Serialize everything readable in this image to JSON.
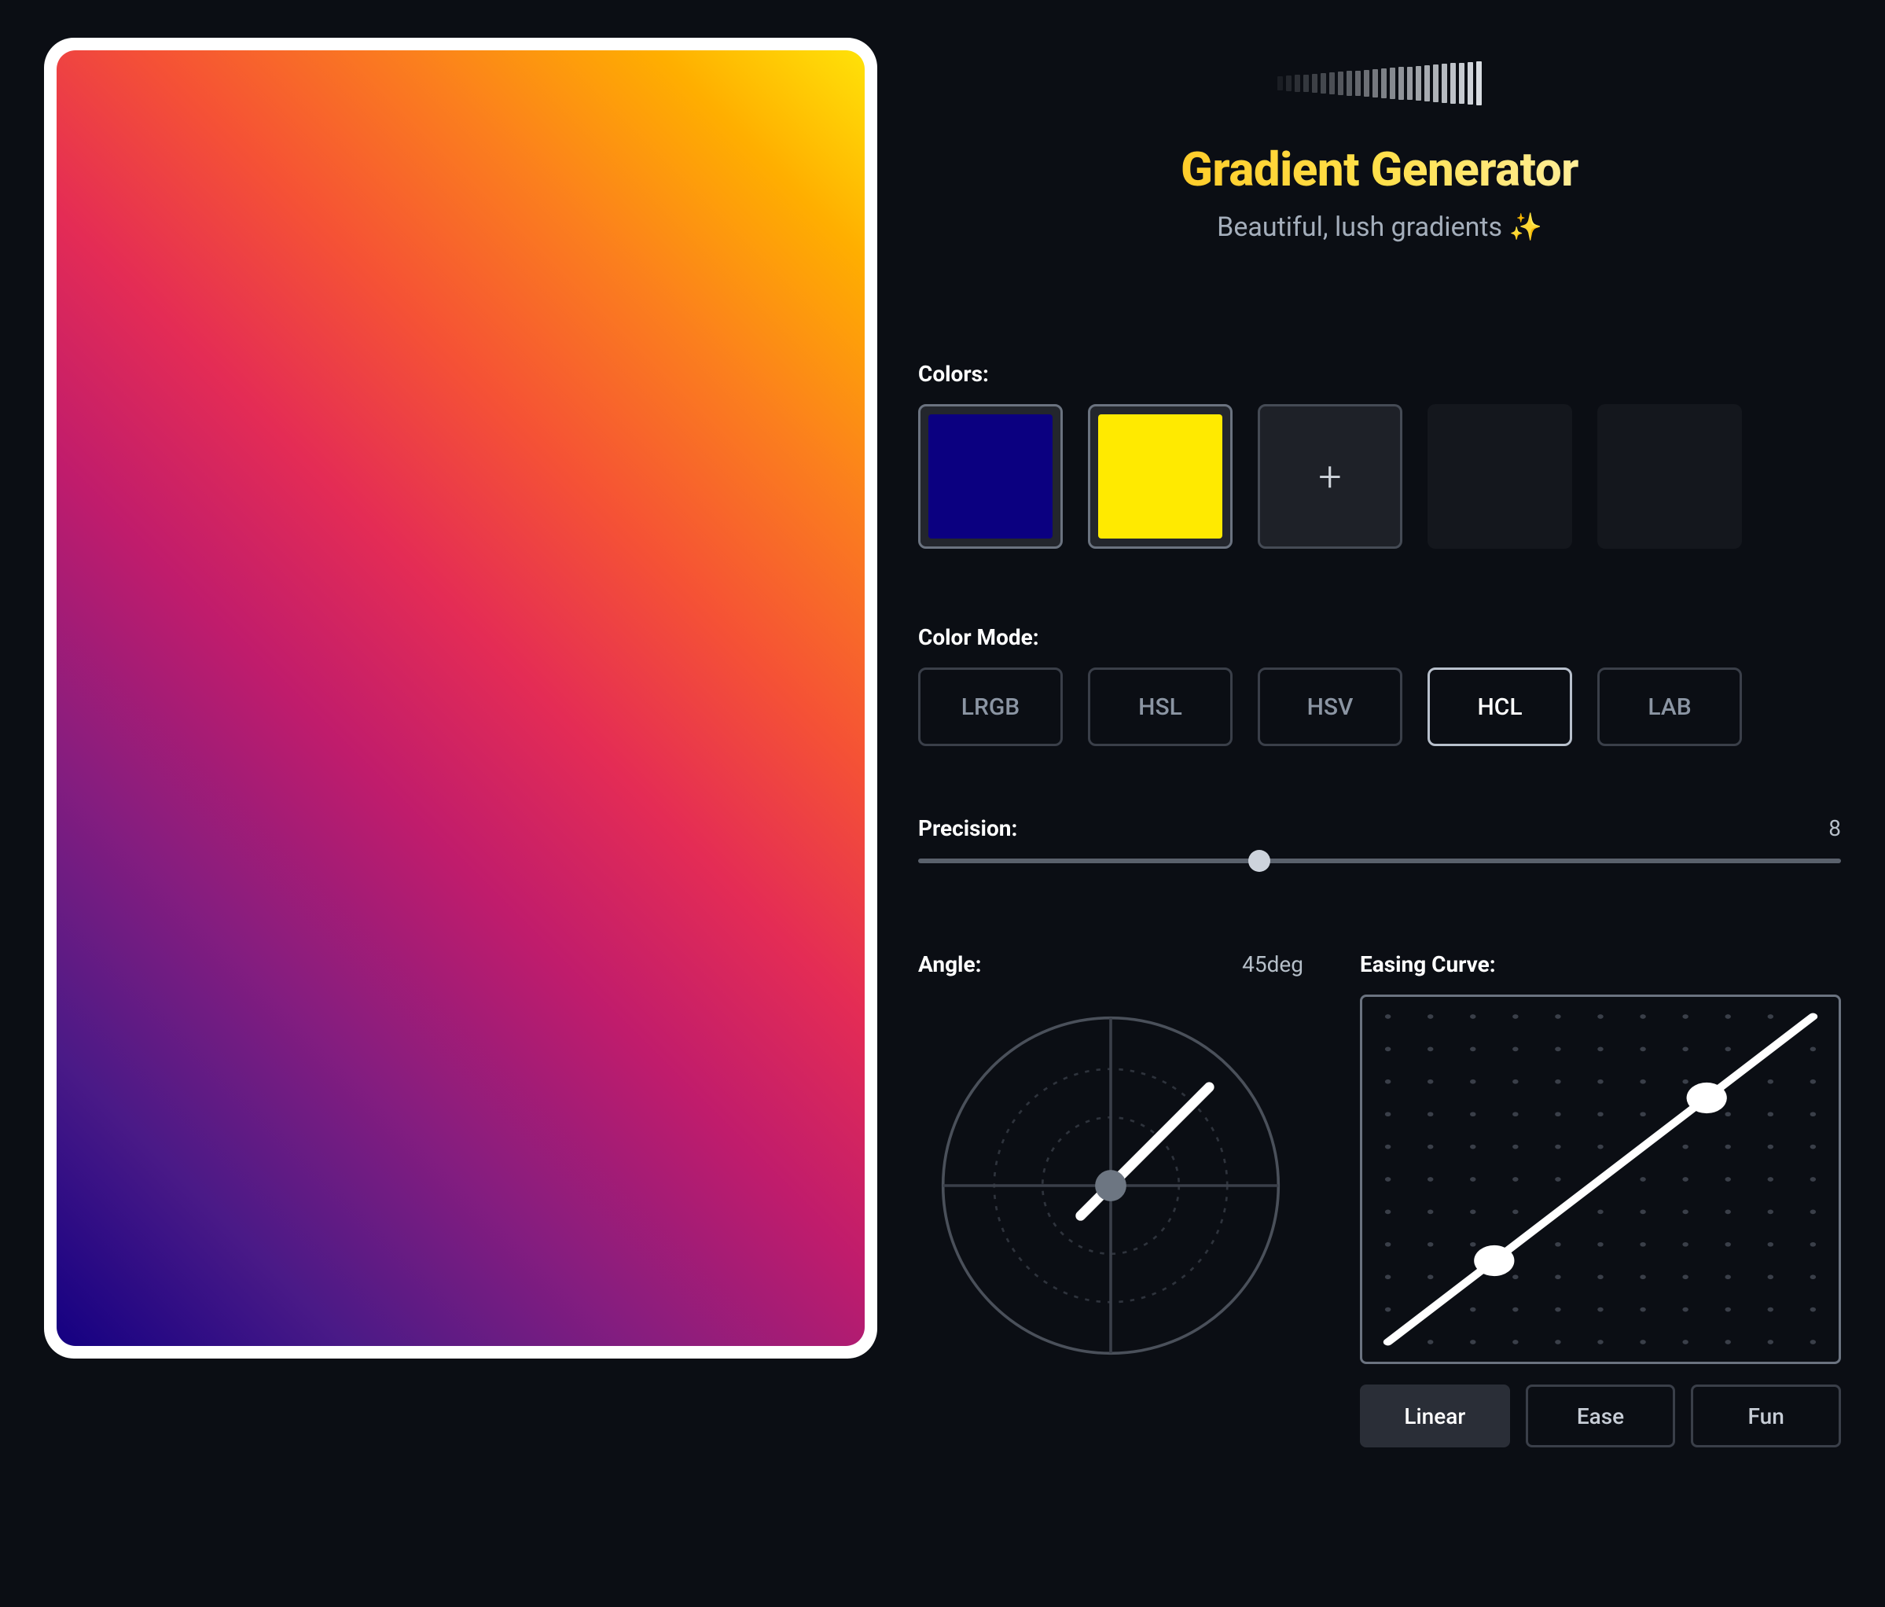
{
  "header": {
    "title": "Gradient Generator",
    "subtitle": "Beautiful, lush gradients ✨"
  },
  "colors": {
    "label": "Colors:",
    "swatches": [
      {
        "hex": "#0b0080"
      },
      {
        "hex": "#ffea00"
      }
    ],
    "add_symbol": "+"
  },
  "colorMode": {
    "label": "Color Mode:",
    "options": [
      "LRGB",
      "HSL",
      "HSV",
      "HCL",
      "LAB"
    ],
    "active": "HCL"
  },
  "precision": {
    "label": "Precision:",
    "value": "8",
    "min": 0,
    "max": 20,
    "percent": 37
  },
  "angle": {
    "label": "Angle:",
    "value": "45deg",
    "degrees": 45
  },
  "easing": {
    "label": "Easing Curve:",
    "presets": [
      "Linear",
      "Ease",
      "Fun"
    ],
    "active": "Linear",
    "points": {
      "p1": {
        "x": 0.25,
        "y": 0.25
      },
      "p2": {
        "x": 0.75,
        "y": 0.75
      }
    }
  },
  "preview": {
    "css_gradient": "linear-gradient(45deg, #140082 0%, #4a1a87 14%, #861d7f 28%, #c01c6c 42%, #e42c55 54%, #f55235 66%, #fb7e1e 78%, #ffae00 90%, #ffe208 100%)"
  }
}
